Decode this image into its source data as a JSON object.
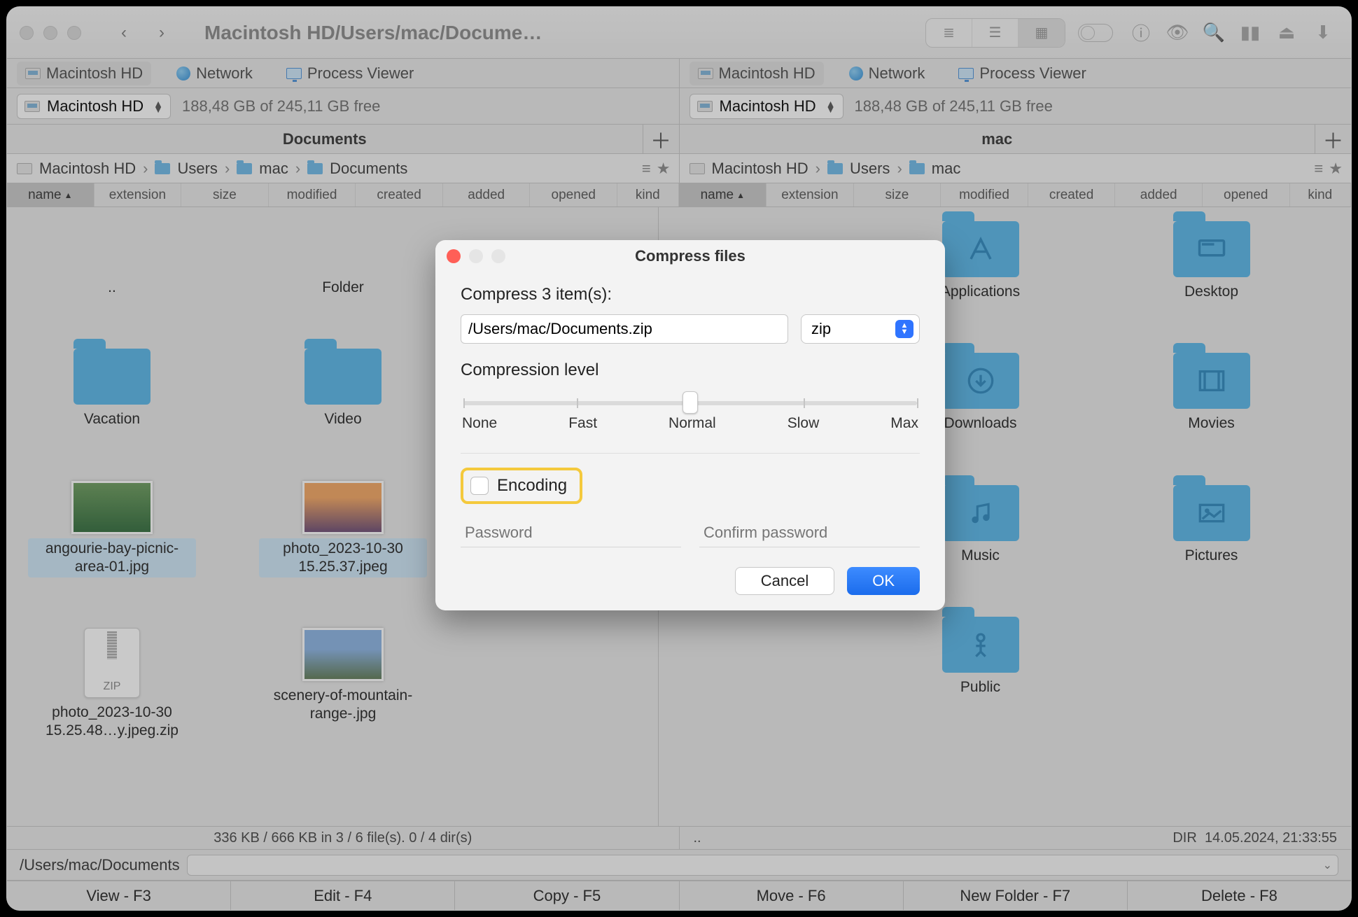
{
  "toolbar": {
    "title": "Macintosh HD/Users/mac/Docume…"
  },
  "favorites": [
    {
      "label": "Macintosh HD",
      "style": "hd",
      "pill": true
    },
    {
      "label": "Network",
      "style": "globe"
    },
    {
      "label": "Process Viewer",
      "style": "mon"
    }
  ],
  "volume": {
    "name": "Macintosh HD",
    "space": "188,48 GB of 245,11 GB free"
  },
  "leftTab": "Documents",
  "rightTab": "mac",
  "crumbs": {
    "left": [
      "Macintosh HD",
      "Users",
      "mac",
      "Documents"
    ],
    "right": [
      "Macintosh HD",
      "Users",
      "mac"
    ]
  },
  "columns": [
    "name",
    "extension",
    "size",
    "modified",
    "created",
    "added",
    "opened",
    "kind"
  ],
  "leftFiles": {
    "up": "..",
    "folder": "Folder",
    "vacation": "Vacation",
    "video": "Video",
    "sel1": "angourie-bay-picnic-area-01.jpg",
    "sel2": "photo_2023-10-30 15.25.37.jpeg",
    "zip": "photo_2023-10-30 15.25.48…y.jpeg.zip",
    "zipLabel": "ZIP",
    "mount": "scenery-of-mountain-range-.jpg"
  },
  "rightFolders": [
    {
      "name": "Applications",
      "glyph": "A"
    },
    {
      "name": "Desktop",
      "glyph": "desk"
    },
    {
      "name": "Downloads",
      "glyph": "↓"
    },
    {
      "name": "Movies",
      "glyph": "film"
    },
    {
      "name": "Music",
      "glyph": "♪"
    },
    {
      "name": "Pictures",
      "glyph": "img"
    },
    {
      "name": "Public",
      "glyph": "pub"
    }
  ],
  "status": {
    "left": "336 KB / 666 KB in 3 / 6 file(s). 0 / 4 dir(s)",
    "rightUp": "..",
    "rightDir": "DIR",
    "rightDate": "14.05.2024, 21:33:55"
  },
  "pathbar": "/Users/mac/Documents",
  "fnkeys": [
    "View - F3",
    "Edit - F4",
    "Copy - F5",
    "Move - F6",
    "New Folder - F7",
    "Delete - F8"
  ],
  "dialog": {
    "title": "Compress files",
    "heading": "Compress 3 item(s):",
    "path": "/Users/mac/Documents.zip",
    "format": "zip",
    "compressionLabel": "Compression level",
    "levels": [
      "None",
      "Fast",
      "Normal",
      "Slow",
      "Max"
    ],
    "encoding": "Encoding",
    "pwd": "Password",
    "pwd2": "Confirm password",
    "cancel": "Cancel",
    "ok": "OK"
  }
}
